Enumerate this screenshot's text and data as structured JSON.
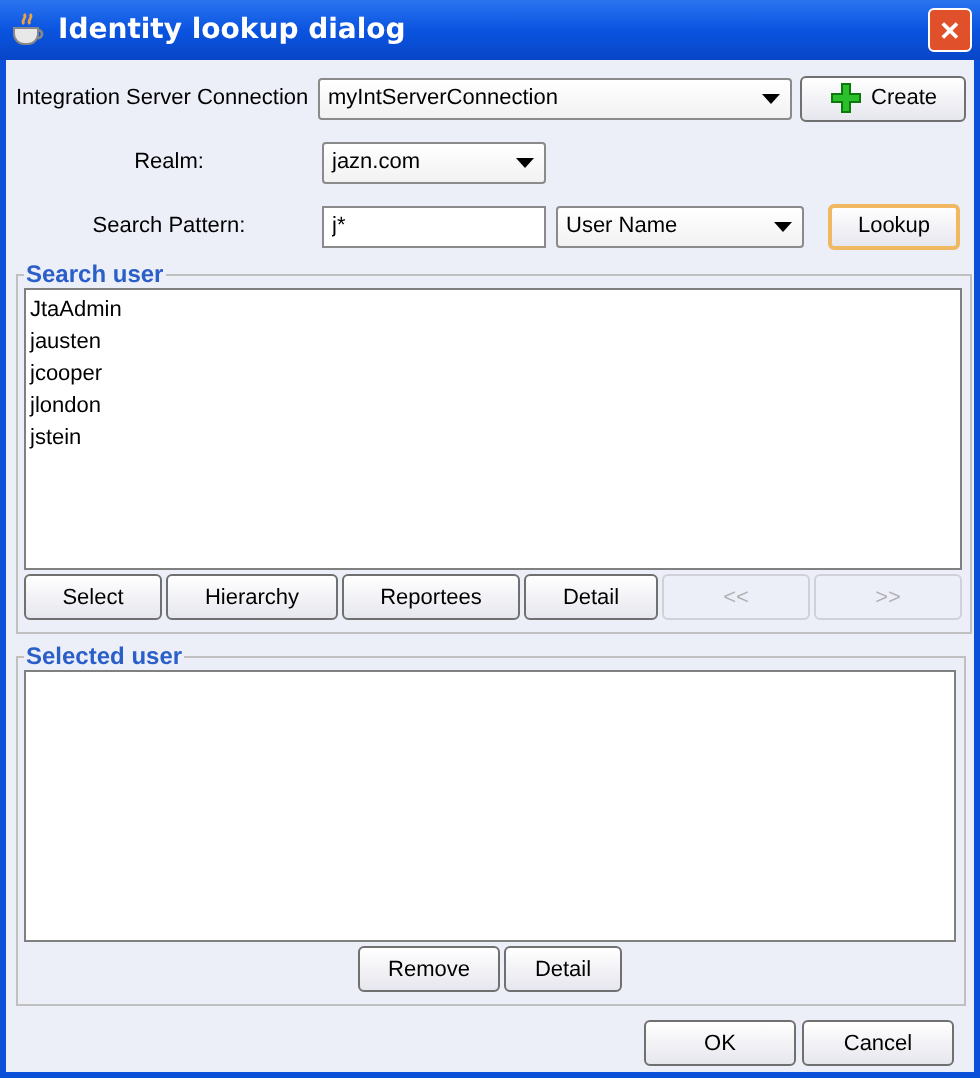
{
  "window": {
    "title": "Identity lookup dialog",
    "close": "✕"
  },
  "connection": {
    "label": "Integration Server Connection",
    "value": "myIntServerConnection",
    "create": "Create"
  },
  "realm": {
    "label": "Realm:",
    "value": "jazn.com"
  },
  "search": {
    "label": "Search Pattern:",
    "value": "j*",
    "type": "User Name",
    "lookup": "Lookup"
  },
  "search_user": {
    "title": "Search user",
    "users": [
      {
        "name": "JtaAdmin"
      },
      {
        "name": "jausten"
      },
      {
        "name": "jcooper"
      },
      {
        "name": "jlondon"
      },
      {
        "name": "jstein"
      }
    ],
    "buttons": [
      {
        "label": "Select",
        "disabled": false
      },
      {
        "label": "Hierarchy",
        "disabled": false
      },
      {
        "label": "Reportees",
        "disabled": false
      },
      {
        "label": "Detail",
        "disabled": false
      },
      {
        "label": "<<",
        "disabled": true
      },
      {
        "label": ">>",
        "disabled": true
      }
    ]
  },
  "selected_user": {
    "title": "Selected user",
    "buttons": [
      {
        "label": "Remove",
        "disabled": false
      },
      {
        "label": "Detail",
        "disabled": false
      }
    ]
  },
  "footer": {
    "buttons": [
      "OK",
      "Cancel"
    ]
  }
}
